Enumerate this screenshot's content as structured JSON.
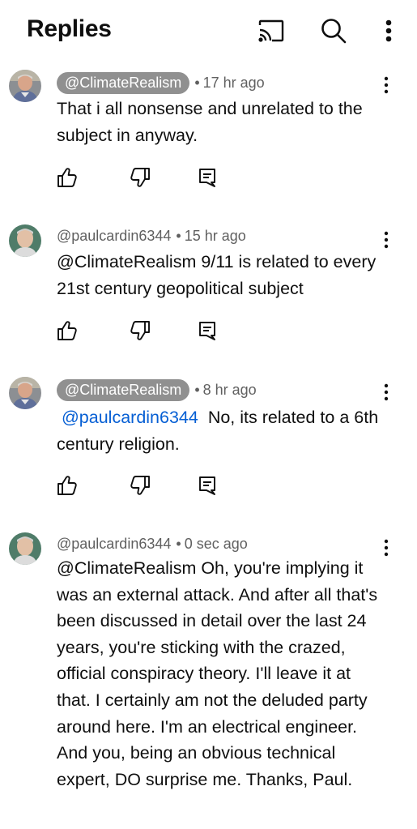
{
  "header": {
    "title": "Replies",
    "icons": [
      "cast-icon",
      "search-icon",
      "more-vert-icon"
    ]
  },
  "comments": [
    {
      "author": "@ClimateRealism",
      "author_highlight": true,
      "time": "17 hr ago",
      "mention": "",
      "text": "That i all nonsense and unrelated to the subject in anyway.",
      "avatar": "avatar-climaterealism"
    },
    {
      "author": "@paulcardin6344",
      "author_highlight": false,
      "time": "15 hr ago",
      "mention": "",
      "text": "@ClimateRealism  9/11 is related to every 21st century geopolitical subject",
      "avatar": "avatar-paulcardin"
    },
    {
      "author": "@ClimateRealism",
      "author_highlight": true,
      "time": "8 hr ago",
      "mention": "@paulcardin6344",
      "text": "No, its related to a 6th century religion.",
      "avatar": "avatar-climaterealism"
    },
    {
      "author": "@paulcardin6344",
      "author_highlight": false,
      "time": "0 sec ago",
      "mention": "",
      "text": "@ClimateRealism  Oh, you're implying it was an external attack. And after all that's been discussed in detail over the last 24 years, you're sticking with the crazed, official conspiracy theory. I'll leave it at that. I certainly am not the deluded party around here. I'm an electrical engineer. And you, being an obvious technical expert,  DO surprise me. Thanks, Paul.",
      "avatar": "avatar-paulcardin"
    }
  ],
  "separator": "•",
  "colors": {
    "text": "#0f0f0f",
    "secondary": "#606060",
    "chip": "#909090",
    "mention": "#065fd4"
  }
}
